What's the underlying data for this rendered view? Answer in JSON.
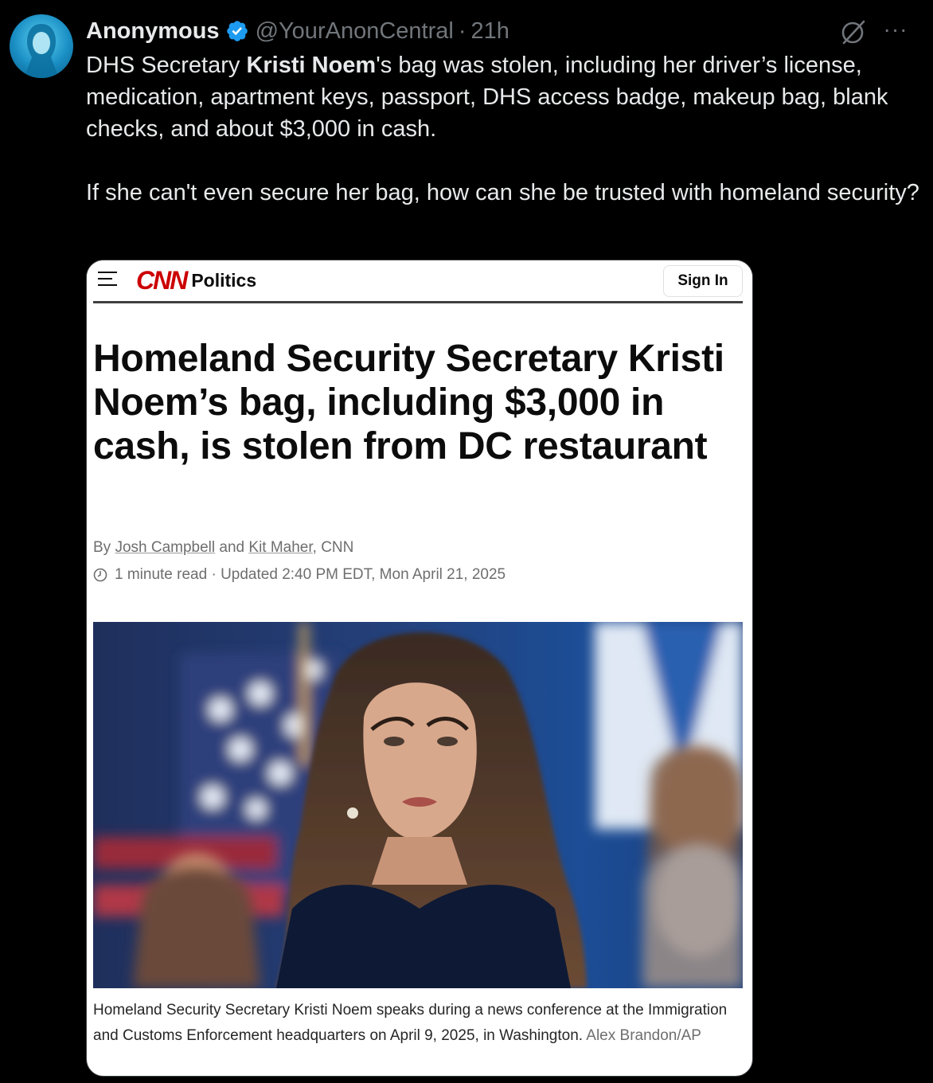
{
  "tweet": {
    "author_name": "Anonymous",
    "handle": "@YourAnonCentral",
    "separator": "·",
    "time": "21h",
    "more_label": "···",
    "text_p1_pre": "DHS Secretary ",
    "text_p1_bold": "Kristi Noem",
    "text_p1_post": "'s bag was stolen, including her driver’s license, medication, apartment keys, passport, DHS access badge, makeup bag, blank checks, and about $3,000 in cash.",
    "text_p2": "If she can't even secure her bag, how can she be trusted with homeland security?"
  },
  "card": {
    "logo": "CNN",
    "section": "Politics",
    "sign_in": "Sign In",
    "headline": "Homeland Security Secretary Kristi Noem’s bag, including $3,000 in cash, is stolen from DC restaurant",
    "byline_prefix": "By ",
    "author1": "Josh Campbell",
    "byline_and": " and ",
    "author2": "Kit Maher",
    "byline_suffix": ", CNN",
    "read_time": "1 minute read",
    "meta_sep": " · ",
    "updated": "Updated 2:40 PM EDT, Mon April 21, 2025",
    "caption": "Homeland Security Secretary Kristi Noem speaks during a news conference at the Immigration and Customs Enforcement headquarters on April 9, 2025, in Washington.",
    "credit": "Alex Brandon/AP"
  },
  "colors": {
    "background": "#000000",
    "text": "#e7e9ea",
    "muted": "#71767b",
    "verified": "#1d9bf0",
    "cnn_red": "#cc0000"
  },
  "icons": [
    "hooded-figure-avatar",
    "verified-badge-icon",
    "grok-icon",
    "more-icon",
    "hamburger-menu-icon",
    "clock-icon"
  ]
}
